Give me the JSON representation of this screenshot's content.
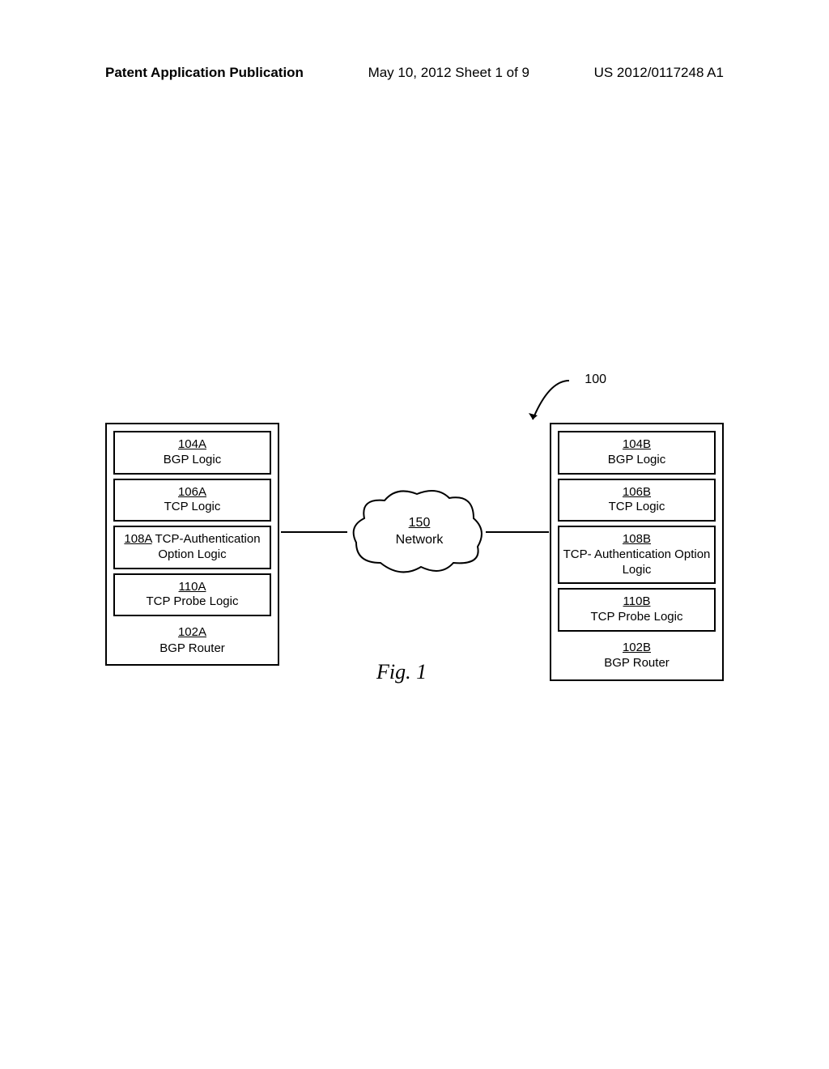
{
  "header": {
    "left": "Patent Application Publication",
    "center": "May 10, 2012  Sheet 1 of 9",
    "right": "US 2012/0117248 A1"
  },
  "diagram": {
    "system_num": "100",
    "router_a": {
      "bgp_logic": {
        "ref": "104A",
        "label": "BGP Logic"
      },
      "tcp_logic": {
        "ref": "106A",
        "label": "TCP Logic"
      },
      "tcp_auth": {
        "ref": "108A",
        "label": "TCP-Authentication Option Logic"
      },
      "tcp_probe": {
        "ref": "110A",
        "label": "TCP Probe Logic"
      },
      "router_label": {
        "ref": "102A",
        "label": "BGP Router"
      }
    },
    "router_b": {
      "bgp_logic": {
        "ref": "104B",
        "label": "BGP Logic"
      },
      "tcp_logic": {
        "ref": "106B",
        "label": "TCP Logic"
      },
      "tcp_auth": {
        "ref": "108B",
        "label": "TCP- Authentication Option Logic"
      },
      "tcp_probe": {
        "ref": "110B",
        "label": "TCP Probe Logic"
      },
      "router_label": {
        "ref": "102B",
        "label": "BGP Router"
      }
    },
    "network": {
      "ref": "150",
      "label": "Network"
    },
    "figure_caption": "Fig. 1"
  }
}
